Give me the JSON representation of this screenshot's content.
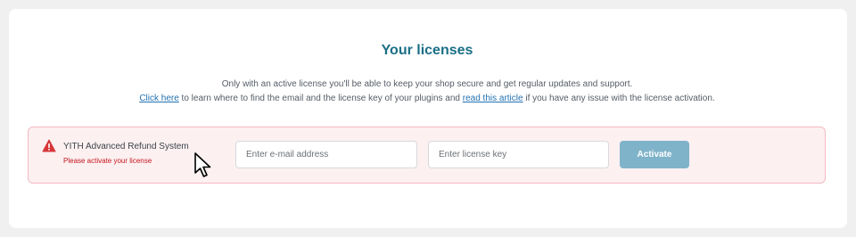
{
  "page": {
    "title": "Your licenses",
    "description_line1": "Only with an active license you'll be able to keep your shop secure and get regular updates and support.",
    "description_line2": {
      "link1": "Click here",
      "text1": " to learn where to find the email and the license key of your plugins and ",
      "link2": "read this article",
      "text2": " if you have any issue with the license activation."
    }
  },
  "license_row": {
    "warning_icon": "warning-triangle-icon",
    "plugin_name": "YITH Advanced Refund System",
    "status": "Please activate your license",
    "email_placeholder": "Enter e-mail address",
    "key_placeholder": "Enter license key",
    "activate_label": "Activate"
  },
  "colors": {
    "title": "#1b6f86",
    "link": "#2271b1",
    "row_background": "#fcf0f1",
    "row_border": "#f3b9c3",
    "warning": "#c4161c",
    "button": "#7fb3c9"
  }
}
